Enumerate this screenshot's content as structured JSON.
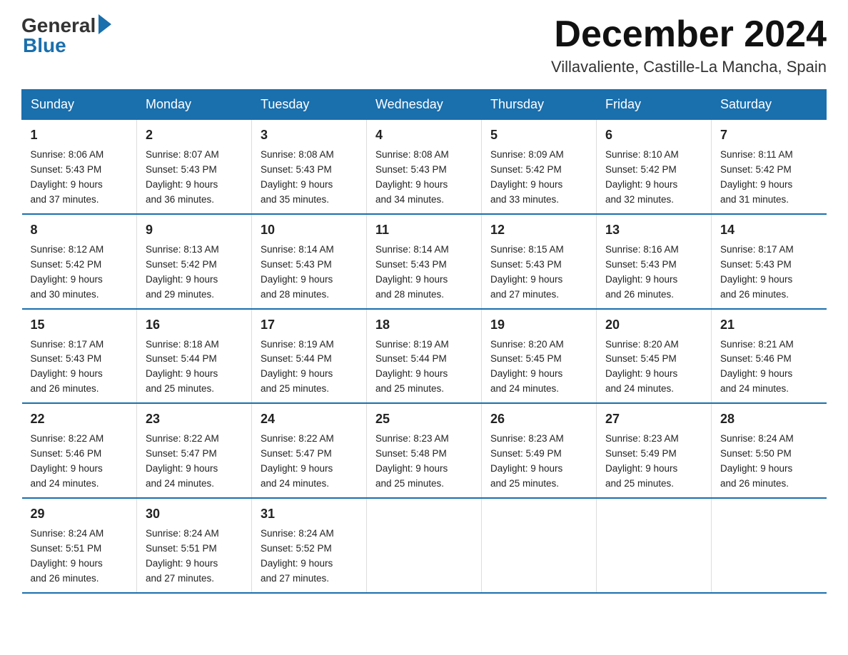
{
  "header": {
    "logo_general": "General",
    "logo_blue": "Blue",
    "month_title": "December 2024",
    "location": "Villavaliente, Castille-La Mancha, Spain"
  },
  "days_of_week": [
    "Sunday",
    "Monday",
    "Tuesday",
    "Wednesday",
    "Thursday",
    "Friday",
    "Saturday"
  ],
  "weeks": [
    [
      {
        "day": "1",
        "sunrise": "8:06 AM",
        "sunset": "5:43 PM",
        "daylight": "9 hours and 37 minutes."
      },
      {
        "day": "2",
        "sunrise": "8:07 AM",
        "sunset": "5:43 PM",
        "daylight": "9 hours and 36 minutes."
      },
      {
        "day": "3",
        "sunrise": "8:08 AM",
        "sunset": "5:43 PM",
        "daylight": "9 hours and 35 minutes."
      },
      {
        "day": "4",
        "sunrise": "8:08 AM",
        "sunset": "5:43 PM",
        "daylight": "9 hours and 34 minutes."
      },
      {
        "day": "5",
        "sunrise": "8:09 AM",
        "sunset": "5:42 PM",
        "daylight": "9 hours and 33 minutes."
      },
      {
        "day": "6",
        "sunrise": "8:10 AM",
        "sunset": "5:42 PM",
        "daylight": "9 hours and 32 minutes."
      },
      {
        "day": "7",
        "sunrise": "8:11 AM",
        "sunset": "5:42 PM",
        "daylight": "9 hours and 31 minutes."
      }
    ],
    [
      {
        "day": "8",
        "sunrise": "8:12 AM",
        "sunset": "5:42 PM",
        "daylight": "9 hours and 30 minutes."
      },
      {
        "day": "9",
        "sunrise": "8:13 AM",
        "sunset": "5:42 PM",
        "daylight": "9 hours and 29 minutes."
      },
      {
        "day": "10",
        "sunrise": "8:14 AM",
        "sunset": "5:43 PM",
        "daylight": "9 hours and 28 minutes."
      },
      {
        "day": "11",
        "sunrise": "8:14 AM",
        "sunset": "5:43 PM",
        "daylight": "9 hours and 28 minutes."
      },
      {
        "day": "12",
        "sunrise": "8:15 AM",
        "sunset": "5:43 PM",
        "daylight": "9 hours and 27 minutes."
      },
      {
        "day": "13",
        "sunrise": "8:16 AM",
        "sunset": "5:43 PM",
        "daylight": "9 hours and 26 minutes."
      },
      {
        "day": "14",
        "sunrise": "8:17 AM",
        "sunset": "5:43 PM",
        "daylight": "9 hours and 26 minutes."
      }
    ],
    [
      {
        "day": "15",
        "sunrise": "8:17 AM",
        "sunset": "5:43 PM",
        "daylight": "9 hours and 26 minutes."
      },
      {
        "day": "16",
        "sunrise": "8:18 AM",
        "sunset": "5:44 PM",
        "daylight": "9 hours and 25 minutes."
      },
      {
        "day": "17",
        "sunrise": "8:19 AM",
        "sunset": "5:44 PM",
        "daylight": "9 hours and 25 minutes."
      },
      {
        "day": "18",
        "sunrise": "8:19 AM",
        "sunset": "5:44 PM",
        "daylight": "9 hours and 25 minutes."
      },
      {
        "day": "19",
        "sunrise": "8:20 AM",
        "sunset": "5:45 PM",
        "daylight": "9 hours and 24 minutes."
      },
      {
        "day": "20",
        "sunrise": "8:20 AM",
        "sunset": "5:45 PM",
        "daylight": "9 hours and 24 minutes."
      },
      {
        "day": "21",
        "sunrise": "8:21 AM",
        "sunset": "5:46 PM",
        "daylight": "9 hours and 24 minutes."
      }
    ],
    [
      {
        "day": "22",
        "sunrise": "8:22 AM",
        "sunset": "5:46 PM",
        "daylight": "9 hours and 24 minutes."
      },
      {
        "day": "23",
        "sunrise": "8:22 AM",
        "sunset": "5:47 PM",
        "daylight": "9 hours and 24 minutes."
      },
      {
        "day": "24",
        "sunrise": "8:22 AM",
        "sunset": "5:47 PM",
        "daylight": "9 hours and 24 minutes."
      },
      {
        "day": "25",
        "sunrise": "8:23 AM",
        "sunset": "5:48 PM",
        "daylight": "9 hours and 25 minutes."
      },
      {
        "day": "26",
        "sunrise": "8:23 AM",
        "sunset": "5:49 PM",
        "daylight": "9 hours and 25 minutes."
      },
      {
        "day": "27",
        "sunrise": "8:23 AM",
        "sunset": "5:49 PM",
        "daylight": "9 hours and 25 minutes."
      },
      {
        "day": "28",
        "sunrise": "8:24 AM",
        "sunset": "5:50 PM",
        "daylight": "9 hours and 26 minutes."
      }
    ],
    [
      {
        "day": "29",
        "sunrise": "8:24 AM",
        "sunset": "5:51 PM",
        "daylight": "9 hours and 26 minutes."
      },
      {
        "day": "30",
        "sunrise": "8:24 AM",
        "sunset": "5:51 PM",
        "daylight": "9 hours and 27 minutes."
      },
      {
        "day": "31",
        "sunrise": "8:24 AM",
        "sunset": "5:52 PM",
        "daylight": "9 hours and 27 minutes."
      },
      null,
      null,
      null,
      null
    ]
  ],
  "labels": {
    "sunrise": "Sunrise:",
    "sunset": "Sunset:",
    "daylight": "Daylight:"
  }
}
